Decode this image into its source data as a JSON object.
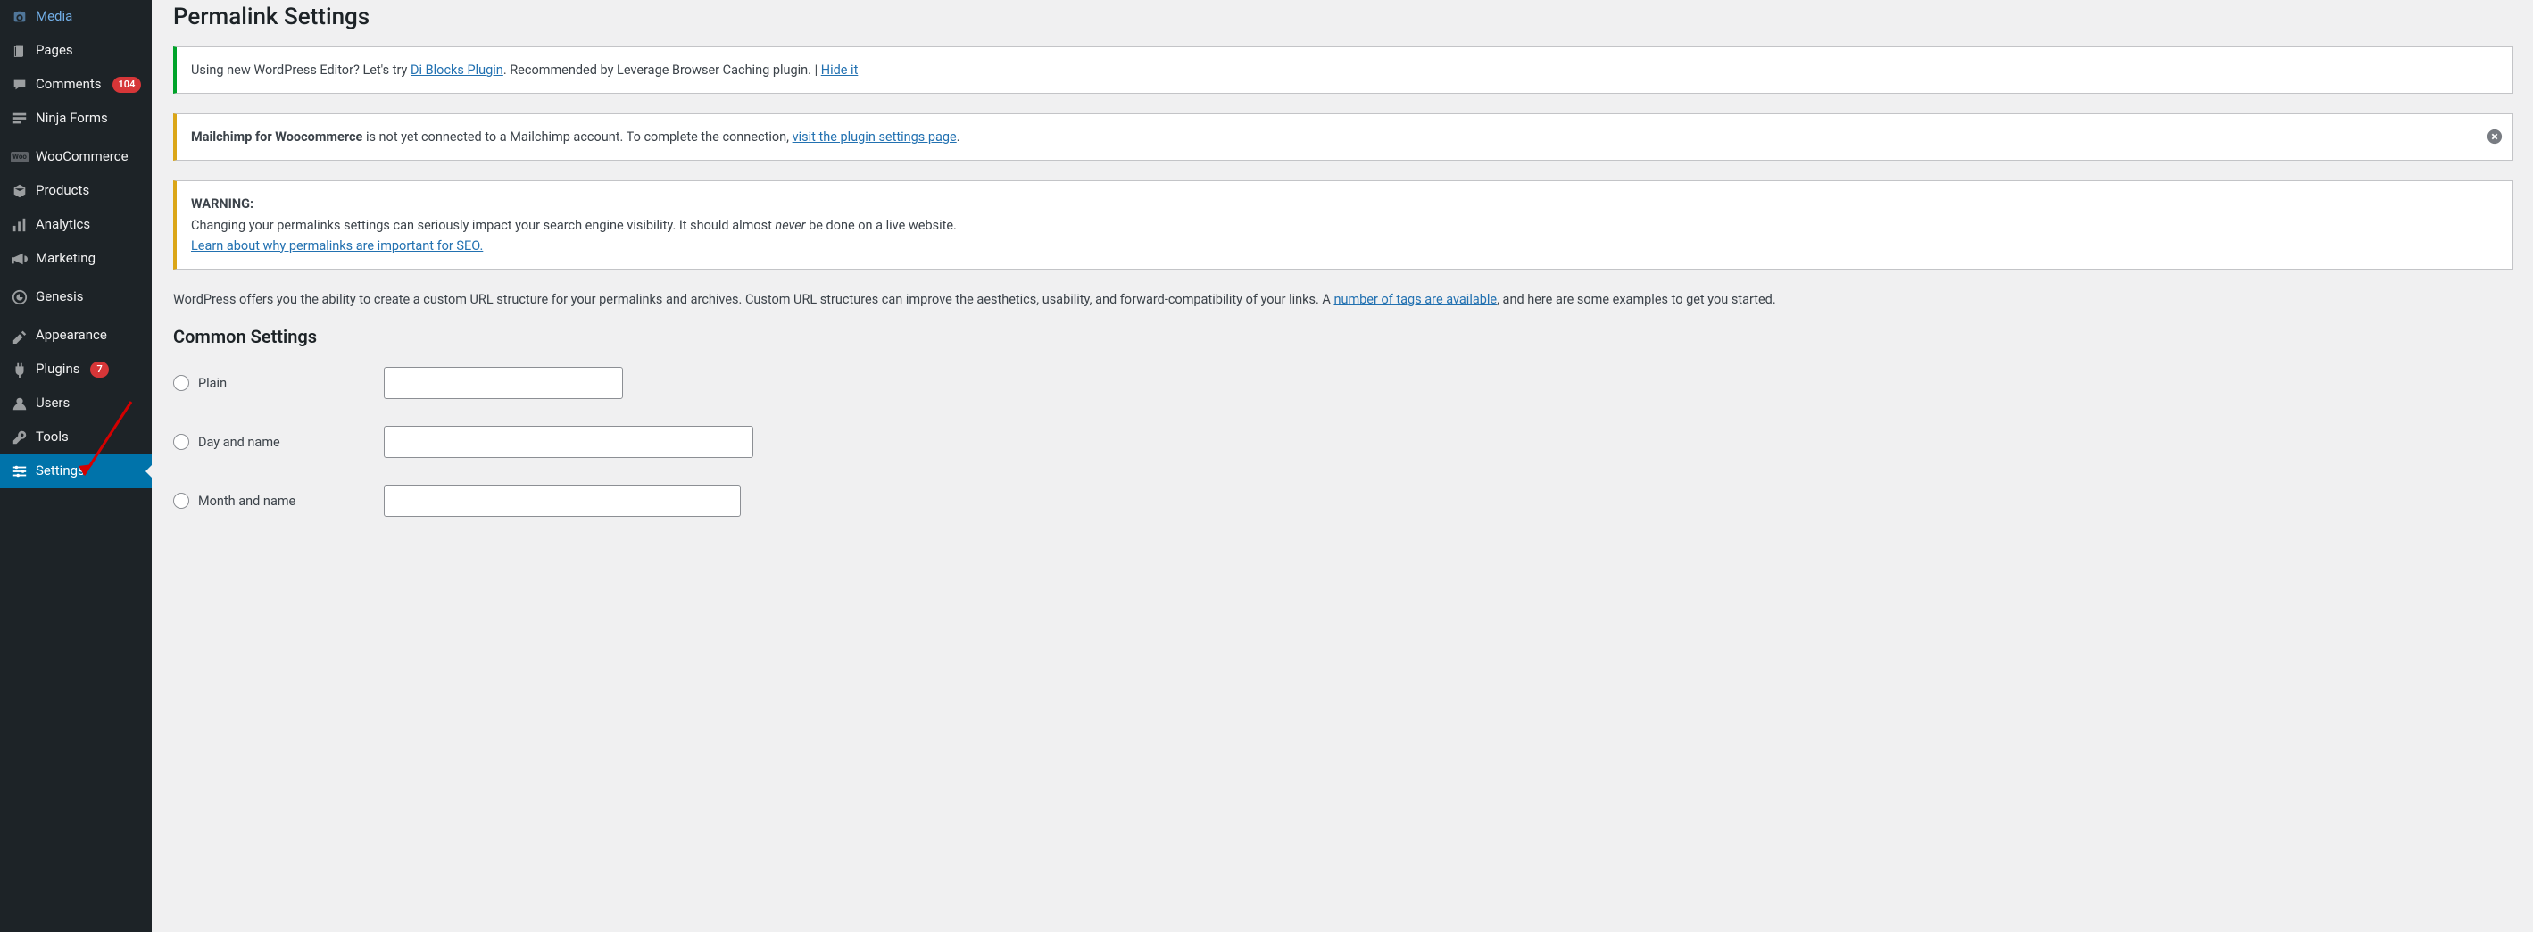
{
  "sidebar": {
    "items": [
      {
        "icon": "camera",
        "label": "Media"
      },
      {
        "icon": "page",
        "label": "Pages"
      },
      {
        "icon": "comment",
        "label": "Comments",
        "badge": "104"
      },
      {
        "icon": "form",
        "label": "Ninja Forms"
      },
      {
        "sep": true
      },
      {
        "icon": "woo",
        "label": "WooCommerce"
      },
      {
        "icon": "product",
        "label": "Products"
      },
      {
        "icon": "analytics",
        "label": "Analytics"
      },
      {
        "icon": "marketing",
        "label": "Marketing"
      },
      {
        "sep": true
      },
      {
        "icon": "genesis",
        "label": "Genesis"
      },
      {
        "sep": true
      },
      {
        "icon": "appearance",
        "label": "Appearance"
      },
      {
        "icon": "plugin",
        "label": "Plugins",
        "badge": "7"
      },
      {
        "icon": "users",
        "label": "Users"
      },
      {
        "icon": "tools",
        "label": "Tools"
      },
      {
        "icon": "settings",
        "label": "Settings",
        "active": true
      }
    ]
  },
  "page": {
    "title": "Permalink Settings"
  },
  "notices": {
    "editor": {
      "text1": "Using new WordPress Editor? Let's try ",
      "link1": "Di Blocks Plugin",
      "text2": ". Recommended by Leverage Browser Caching plugin. | ",
      "link2": "Hide it"
    },
    "mailchimp": {
      "strong": "Mailchimp for Woocommerce",
      "text1": " is not yet connected to a Mailchimp account. To complete the connection, ",
      "link": "visit the plugin settings page",
      "text2": "."
    },
    "warning": {
      "heading": "WARNING:",
      "text1": "Changing your permalinks settings can seriously impact your search engine visibility. It should almost ",
      "em": "never",
      "text2": " be done on a live website.",
      "link": "Learn about why permalinks are important for SEO."
    }
  },
  "intro": {
    "text1": "WordPress offers you the ability to create a custom URL structure for your permalinks and archives. Custom URL structures can improve the aesthetics, usability, and forward-compatibility of your links. A ",
    "link": "number of tags are available",
    "text2": ", and here are some examples to get you started."
  },
  "section": {
    "common": "Common Settings"
  },
  "options": {
    "plain": "Plain",
    "day_name": "Day and name",
    "month_name": "Month and name"
  }
}
